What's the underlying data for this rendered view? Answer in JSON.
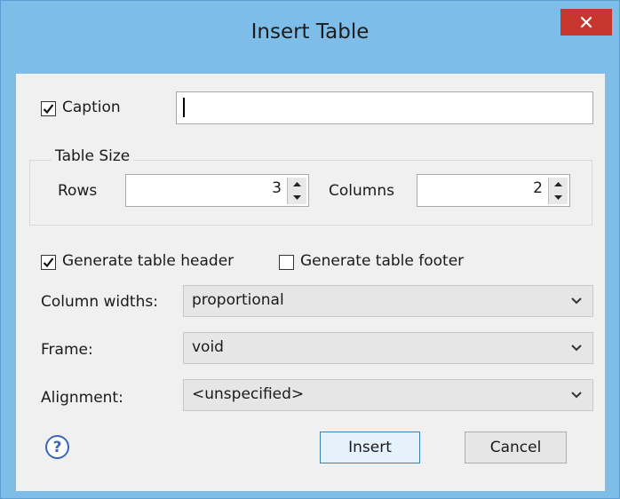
{
  "window": {
    "title": "Insert Table"
  },
  "icons": {
    "close": "close-icon",
    "help": "help-icon",
    "check": "checkmark-icon",
    "dropdown": "chevron-down-icon"
  },
  "caption": {
    "label": "Caption",
    "checked": true,
    "value": ""
  },
  "table_size": {
    "legend": "Table Size",
    "rows_label": "Rows",
    "rows_value": "3",
    "columns_label": "Columns",
    "columns_value": "2"
  },
  "options": {
    "header_label": "Generate table header",
    "header_checked": true,
    "footer_label": "Generate table footer",
    "footer_checked": false
  },
  "fields": {
    "column_widths_label": "Column widths:",
    "column_widths_value": "proportional",
    "frame_label": "Frame:",
    "frame_value": "void",
    "alignment_label": "Alignment:",
    "alignment_value": "<unspecified>"
  },
  "buttons": {
    "insert": "Insert",
    "cancel": "Cancel"
  }
}
